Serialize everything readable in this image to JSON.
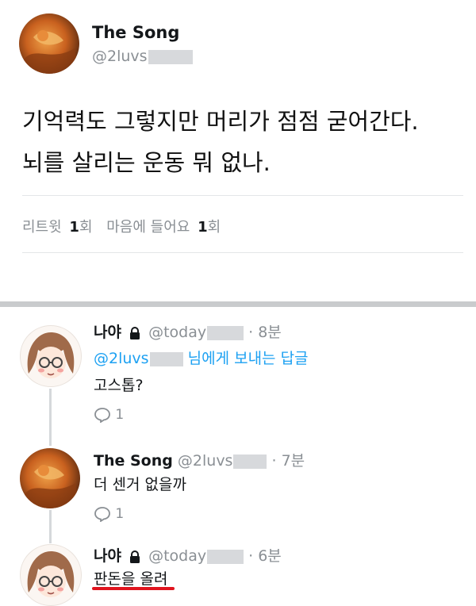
{
  "tweet": {
    "display_name": "The Song",
    "handle": "@2luvs",
    "text_line1": "기억력도 그렇지만 머리가 점점 굳어간다.",
    "text_line2": "뇌를 살리는 운동 뭐 없나.",
    "retweet_label": "리트윗",
    "retweet_count": "1",
    "retweet_unit": "회",
    "likes_label": "마음에 들어요",
    "likes_count": "1",
    "likes_unit": "회"
  },
  "replies": [
    {
      "display_name": "나야",
      "handle": "@today",
      "time": "· 8분",
      "locked": true,
      "reply_to_handle": "@2luvs",
      "reply_to_suffix": "님에게 보내는 답글",
      "text": "고스톱?",
      "reply_count": "1"
    },
    {
      "display_name": "The Song",
      "handle": "@2luvs",
      "time": "· 7분",
      "locked": false,
      "text": "더 센거 없을까",
      "reply_count": "1"
    },
    {
      "display_name": "나야",
      "handle": "@today",
      "time": "· 6분",
      "locked": true,
      "text": "판돈을 올려",
      "highlight_color": "#e0141e"
    }
  ],
  "colors": {
    "link_blue": "#1da1f2",
    "muted_gray": "#8a8f94",
    "divider": "#c9cbcd",
    "underline_red": "#e0141e"
  },
  "icons": {
    "lock": "lock-icon",
    "reply": "reply-bubble-icon",
    "avatar_painting": "painting-avatar",
    "avatar_cartoon": "cartoon-girl-avatar"
  }
}
